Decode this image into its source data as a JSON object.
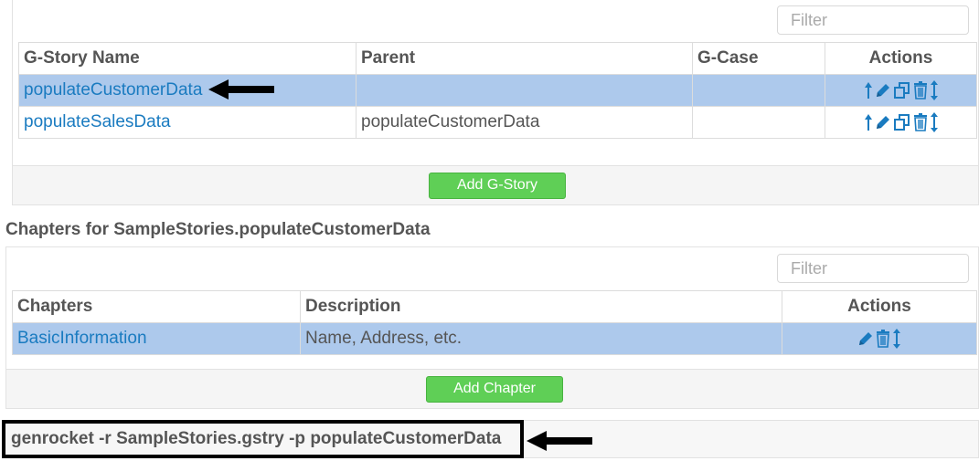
{
  "stories": {
    "filter_placeholder": "Filter",
    "columns": {
      "name": "G-Story Name",
      "parent": "Parent",
      "gcase": "G-Case",
      "actions": "Actions"
    },
    "rows": [
      {
        "name": "populateCustomerData",
        "parent": "",
        "gcase": "",
        "selected": true
      },
      {
        "name": "populateSalesData",
        "parent": "populateCustomerData",
        "gcase": "",
        "selected": false
      }
    ],
    "row_action_icons": [
      "arrow-up-icon",
      "pencil-icon",
      "copy-icon",
      "trash-icon",
      "arrows-vertical-icon"
    ],
    "add_button": "Add G-Story"
  },
  "chapters": {
    "title": "Chapters for SampleStories.populateCustomerData",
    "filter_placeholder": "Filter",
    "columns": {
      "chapters": "Chapters",
      "description": "Description",
      "actions": "Actions"
    },
    "rows": [
      {
        "chapter": "BasicInformation",
        "description": "Name, Address, etc.",
        "selected": true
      }
    ],
    "row_action_icons": [
      "pencil-icon",
      "trash-icon",
      "arrows-vertical-icon"
    ],
    "add_button": "Add Chapter"
  },
  "command": {
    "text": "genrocket -r SampleStories.gstry -p populateCustomerData"
  },
  "colors": {
    "link": "#1a7bc0",
    "selected_row": "#adc9ec",
    "button_green": "#5fcf56",
    "icon_blue": "#1a7bc0"
  }
}
